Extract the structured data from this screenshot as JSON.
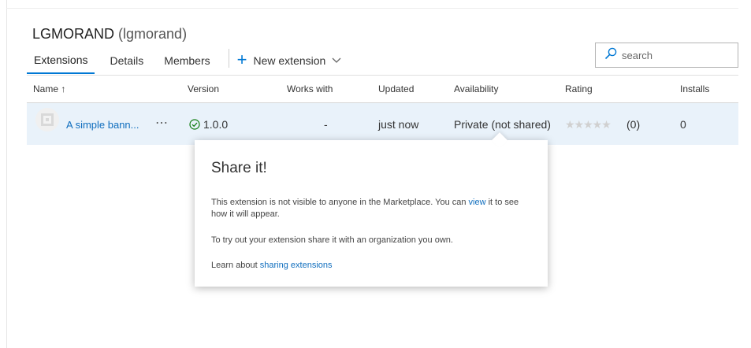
{
  "publisher": {
    "name": "LGMORAND",
    "id": "(lgmorand)"
  },
  "tabs": [
    {
      "label": "Extensions",
      "active": true
    },
    {
      "label": "Details",
      "active": false
    },
    {
      "label": "Members",
      "active": false
    }
  ],
  "new_extension": {
    "label": "New extension",
    "icon": "plus-icon",
    "menu_icon": "chevron-down-icon"
  },
  "search": {
    "placeholder": "search",
    "value": "",
    "icon": "search-icon"
  },
  "table": {
    "columns": {
      "name": "Name ↑",
      "version": "Version",
      "works_with": "Works with",
      "updated": "Updated",
      "availability": "Availability",
      "rating": "Rating",
      "installs": "Installs"
    },
    "rows": [
      {
        "name": "A simple bann...",
        "more": "⋯",
        "version": "1.0.0",
        "version_status_icon": "check-circle-icon",
        "works_with": "-",
        "updated": "just now",
        "availability": "Private (not shared)",
        "stars": "★★★★★",
        "rating_count": "(0)",
        "installs": "0"
      }
    ]
  },
  "callout": {
    "title": "Share it!",
    "p1_before": "This extension is not visible to anyone in the Marketplace. You can ",
    "p1_link": "view",
    "p1_after": " it to see how it will appear.",
    "p2": "To try out your extension share it with an organization you own.",
    "p3_before": "Learn about ",
    "p3_link": "sharing extensions"
  },
  "colors": {
    "accent": "#0078d4",
    "link": "#106ebe",
    "row_selected": "#e9f2fa",
    "success": "#107c10"
  }
}
